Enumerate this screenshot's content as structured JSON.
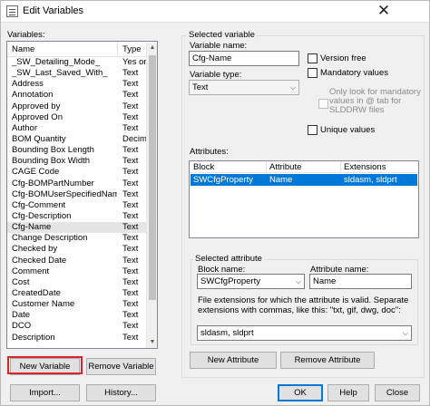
{
  "window": {
    "title": "Edit Variables",
    "close_glyph": "✕"
  },
  "variables": {
    "label": "Variables:",
    "columns": {
      "name": "Name",
      "type": "Type"
    },
    "rows": [
      {
        "name": "_SW_Detailing_Mode_",
        "type": "Yes or No"
      },
      {
        "name": "_SW_Last_Saved_With_",
        "type": "Text"
      },
      {
        "name": "Address",
        "type": "Text"
      },
      {
        "name": "Annotation",
        "type": "Text"
      },
      {
        "name": "Approved by",
        "type": "Text"
      },
      {
        "name": "Approved On",
        "type": "Text"
      },
      {
        "name": "Author",
        "type": "Text"
      },
      {
        "name": "BOM Quantity",
        "type": "Decimal"
      },
      {
        "name": "Bounding Box Length",
        "type": "Text"
      },
      {
        "name": "Bounding Box Width",
        "type": "Text"
      },
      {
        "name": "CAGE Code",
        "type": "Text"
      },
      {
        "name": "Cfg-BOMPartNumber",
        "type": "Text"
      },
      {
        "name": "Cfg-BOMUserSpecifiedName",
        "type": "Text"
      },
      {
        "name": "Cfg-Comment",
        "type": "Text"
      },
      {
        "name": "Cfg-Description",
        "type": "Text"
      },
      {
        "name": "Cfg-Name",
        "type": "Text"
      },
      {
        "name": "Change Description",
        "type": "Text"
      },
      {
        "name": "Checked by",
        "type": "Text"
      },
      {
        "name": "Checked Date",
        "type": "Text"
      },
      {
        "name": "Comment",
        "type": "Text"
      },
      {
        "name": "Cost",
        "type": "Text"
      },
      {
        "name": "CreatedDate",
        "type": "Text"
      },
      {
        "name": "Customer Name",
        "type": "Text"
      },
      {
        "name": "Date",
        "type": "Text"
      },
      {
        "name": "DCO",
        "type": "Text"
      },
      {
        "name": "Description",
        "type": "Text"
      }
    ],
    "selected_index": 15,
    "new_button": "New Variable",
    "remove_button": "Remove Variable",
    "import_button": "Import...",
    "history_button": "History..."
  },
  "selected_variable": {
    "group_label": "Selected variable",
    "name_label": "Variable name:",
    "name_value": "Cfg-Name",
    "type_label": "Variable type:",
    "type_value": "Text",
    "version_free": "Version free",
    "mandatory": "Mandatory values",
    "lookup_line1": "Only look for mandatory",
    "lookup_line2": "values in @ tab for",
    "lookup_line3": "SLDDRW files",
    "unique": "Unique values"
  },
  "attributes": {
    "label": "Attributes:",
    "columns": {
      "block": "Block",
      "attribute": "Attribute",
      "extensions": "Extensions"
    },
    "rows": [
      {
        "block": "SWCfgProperty",
        "attribute": "Name",
        "extensions": "sldasm, sldprt"
      }
    ],
    "selected_group_label": "Selected attribute",
    "block_label": "Block name:",
    "block_value": "SWCfgProperty",
    "attr_label": "Attribute name:",
    "attr_value": "Name",
    "ext_help": "File extensions for which the attribute is valid. Separate extensions with commas, like this: \"txt, gif, dwg, doc\":",
    "ext_value": "sldasm, sldprt",
    "new_button": "New Attribute",
    "remove_button": "Remove Attribute"
  },
  "dialog_buttons": {
    "ok": "OK",
    "help": "Help",
    "close": "Close"
  }
}
